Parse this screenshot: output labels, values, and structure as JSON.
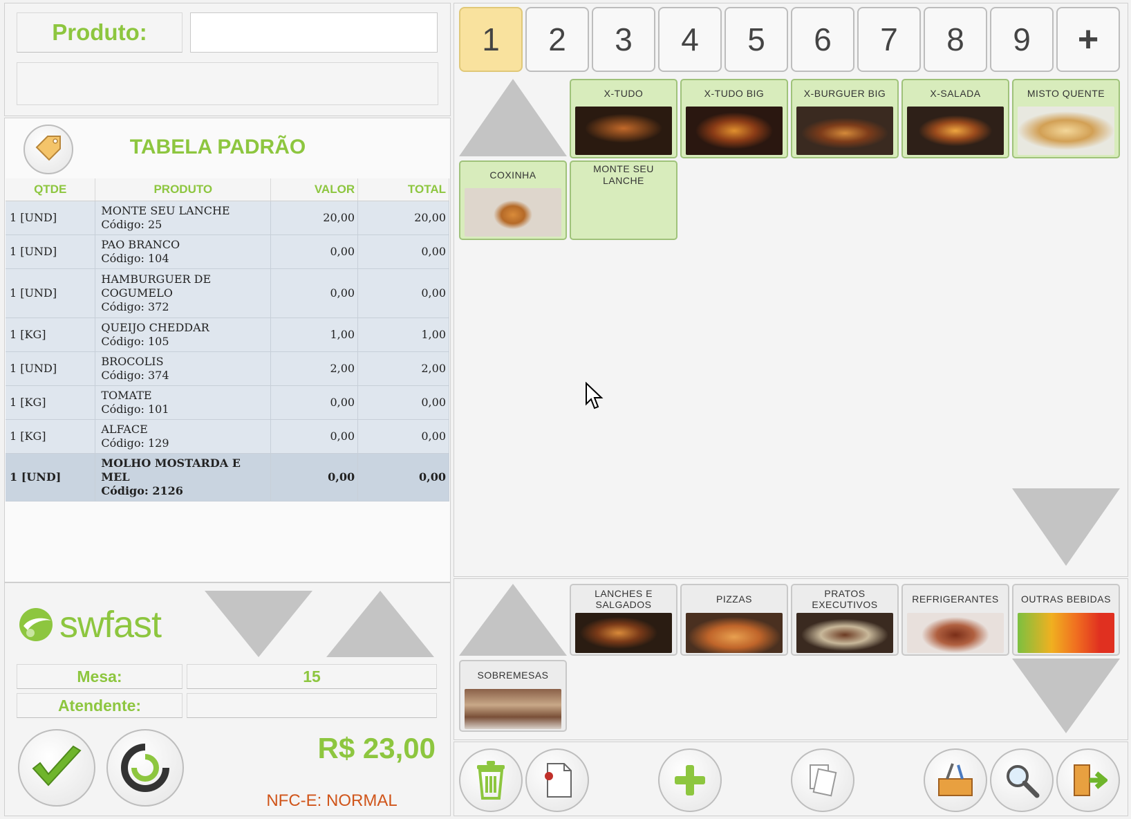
{
  "header": {
    "product_label": "Produto:",
    "product_value": "",
    "product_description": ""
  },
  "price_table": {
    "title": "TABELA PADRÃO",
    "icon": "price-tag-icon"
  },
  "order_table": {
    "columns": [
      "QTDE",
      "PRODUTO",
      "VALOR",
      "TOTAL"
    ],
    "rows": [
      {
        "qty": "1 [UND]",
        "name": "MONTE SEU LANCHE",
        "code": "Código: 25",
        "value": "20,00",
        "total": "20,00"
      },
      {
        "qty": "1 [UND]",
        "name": "PAO BRANCO",
        "code": "Código: 104",
        "value": "0,00",
        "total": "0,00"
      },
      {
        "qty": "1 [UND]",
        "name": "HAMBURGUER DE COGUMELO",
        "code": "Código: 372",
        "value": "0,00",
        "total": "0,00"
      },
      {
        "qty": "1 [KG]",
        "name": "QUEIJO CHEDDAR",
        "code": "Código: 105",
        "value": "1,00",
        "total": "1,00"
      },
      {
        "qty": "1 [UND]",
        "name": "BROCOLIS",
        "code": "Código: 374",
        "value": "2,00",
        "total": "2,00"
      },
      {
        "qty": "1 [KG]",
        "name": "TOMATE",
        "code": "Código: 101",
        "value": "0,00",
        "total": "0,00"
      },
      {
        "qty": "1 [KG]",
        "name": "ALFACE",
        "code": "Código: 129",
        "value": "0,00",
        "total": "0,00"
      },
      {
        "qty": "1 [UND]",
        "name": "MOLHO MOSTARDA E MEL",
        "code": "Código: 2126",
        "value": "0,00",
        "total": "0,00"
      }
    ]
  },
  "footer": {
    "brand": "swfast",
    "table_label": "Mesa:",
    "table_value": "15",
    "attendant_label": "Atendente:",
    "attendant_value": "",
    "total": "R$ 23,00",
    "nfce_status": "NFC-E: NORMAL"
  },
  "page_tabs": [
    "1",
    "2",
    "3",
    "4",
    "5",
    "6",
    "7",
    "8",
    "9",
    "+"
  ],
  "products": [
    {
      "label": "X-TUDO",
      "icon": "burger-photo"
    },
    {
      "label": "X-TUDO BIG",
      "icon": "burger-photo"
    },
    {
      "label": "X-BURGUER BIG",
      "icon": "burger-photo"
    },
    {
      "label": "X-SALADA",
      "icon": "burger-photo"
    },
    {
      "label": "MISTO QUENTE",
      "icon": "sandwich-photo"
    },
    {
      "label": "COXINHA",
      "icon": "coxinha-photo"
    },
    {
      "label": "MONTE SEU LANCHE",
      "icon": ""
    }
  ],
  "categories": [
    {
      "label": "LANCHES E SALGADOS",
      "icon": "burger-photo"
    },
    {
      "label": "PIZZAS",
      "icon": "pizza-photo"
    },
    {
      "label": "PRATOS EXECUTIVOS",
      "icon": "plate-photo"
    },
    {
      "label": "REFRIGERANTES",
      "icon": "soda-photo"
    },
    {
      "label": "OUTRAS BEBIDAS",
      "icon": "juice-photo"
    },
    {
      "label": "SOBREMESAS",
      "icon": "dessert-photo"
    }
  ],
  "colors": {
    "accent_green": "#8dc63f",
    "active_tab": "#f9e29e",
    "product_card": "#d8ecbc",
    "nfce_orange": "#d0551a"
  }
}
